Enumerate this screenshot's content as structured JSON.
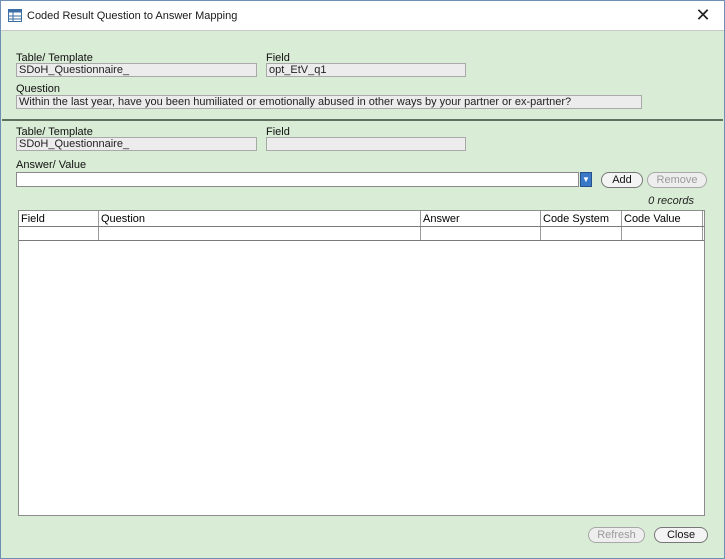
{
  "window": {
    "title": "Coded Result Question to Answer Mapping",
    "close_glyph": "✕"
  },
  "top_section": {
    "table_label": "Table/ Template",
    "table_value": "SDoH_Questionnaire_",
    "field_label": "Field",
    "field_value": "opt_EtV_q1",
    "question_label": "Question",
    "question_value": "Within the last year, have you been humiliated or emotionally abused in  other ways by your partner or ex-partner?"
  },
  "mapping_section": {
    "table_label": "Table/ Template",
    "table_value": "SDoH_Questionnaire_",
    "field_label": "Field",
    "field_value": "",
    "answer_label": "Answer/ Value",
    "answer_value": "",
    "add_label": "Add",
    "remove_label": "Remove",
    "records_text": "0 records"
  },
  "grid": {
    "columns": [
      "Field",
      "Question",
      "Answer",
      "Code System",
      "Code Value"
    ]
  },
  "footer": {
    "refresh_label": "Refresh",
    "close_label": "Close"
  },
  "icons": {
    "title_icon": "table-icon",
    "dropdown_icon": "chevron-down-icon"
  }
}
